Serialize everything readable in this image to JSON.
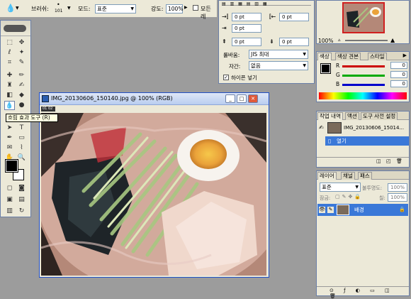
{
  "options": {
    "brush_label": "브러쉬:",
    "brush_size": "101",
    "mode_label": "모드:",
    "mode_value": "표준",
    "strength_label": "강도:",
    "strength_value": "100%",
    "all_layers_label": "모든 레"
  },
  "tooltip": "흐림 효과 도구 (R)",
  "document": {
    "title": "IMG_20130606_150140.jpg @ 100% (RGB)",
    "ruler": "01 02"
  },
  "character": {
    "fields": [
      "0 pt",
      "0 pt",
      "0 pt",
      "0 pt",
      "0 pt"
    ],
    "burasi_label": "룰바움:",
    "burasi_value": "JIS 최대",
    "jagan_label": "자간:",
    "jagan_value": "없음",
    "hyphen_label": "하이픈 넣기"
  },
  "navigator": {
    "zoom": "100%"
  },
  "color": {
    "tabs": [
      "색상",
      "색상 견본",
      "스타일"
    ],
    "channels": [
      {
        "label": "R",
        "value": "0",
        "color": "#d00000"
      },
      {
        "label": "G",
        "value": "0",
        "color": "#00a000"
      },
      {
        "label": "B",
        "value": "0",
        "color": "#0000d0"
      }
    ]
  },
  "history": {
    "tabs": [
      "작업 내역",
      "액션",
      "도구 사전 설정"
    ],
    "snapshot": "IMG_20130606_15014...",
    "step": "열기"
  },
  "layers": {
    "tabs": [
      "레이어",
      "채널",
      "패스"
    ],
    "blend_mode": "표준",
    "opacity_label": "불투명도:",
    "opacity": "100%",
    "lock_label": "잠금:",
    "fill_label": "칠:",
    "fill": "100%",
    "layer_name": "배경"
  }
}
